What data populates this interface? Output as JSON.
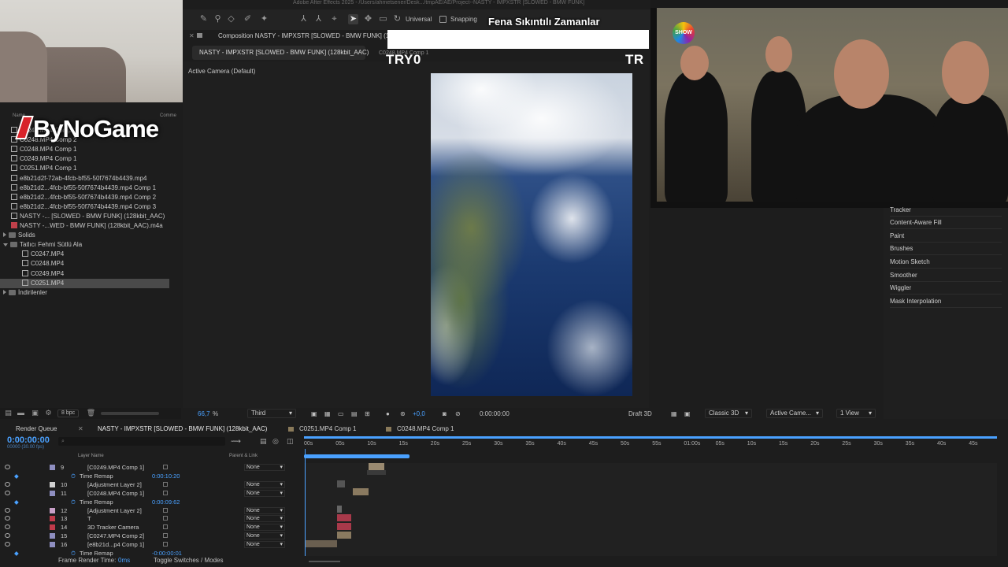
{
  "app": {
    "title": "Adobe After Effects 2025 - /Users/ahmetsener/Desk.../tmpAE/AE/Project--NASTY - IMPXSTR [SLOWED - BMW FUNK]"
  },
  "toolbar": {
    "universal": "Universal",
    "snapping": "Snapping"
  },
  "overlay": {
    "title": "Fena Sıkıntılı Zamanlar",
    "tryo_left": "TRY0",
    "tryo_right": "TR",
    "logo": "ByNoGame",
    "show_logo": "SHOW"
  },
  "project": {
    "columns": {
      "name": "Name",
      "comment": "Comme"
    },
    "items": [
      {
        "label": "C0247.MP4 Comp 1",
        "type": "comp",
        "indent": 0
      },
      {
        "label": "C0248.MP4 Comp 2",
        "type": "comp",
        "indent": 0
      },
      {
        "label": "C0248.MP4 Comp 1",
        "type": "comp",
        "indent": 0
      },
      {
        "label": "C0249.MP4 Comp 1",
        "type": "comp",
        "indent": 0
      },
      {
        "label": "C0251.MP4 Comp 1",
        "type": "comp",
        "indent": 0
      },
      {
        "label": "e8b21d2f-72ab-4fcb-bf55-50f7674b4439.mp4",
        "type": "file",
        "indent": 0
      },
      {
        "label": "e8b21d2...4fcb-bf55-50f7674b4439.mp4 Comp 1",
        "type": "comp",
        "indent": 0
      },
      {
        "label": "e8b21d2...4fcb-bf55-50f7674b4439.mp4 Comp 2",
        "type": "comp",
        "indent": 0
      },
      {
        "label": "e8b21d2...4fcb-bf55-50f7674b4439.mp4 Comp 3",
        "type": "comp",
        "indent": 0
      },
      {
        "label": "NASTY -... [SLOWED - BMW FUNK] (128kbit_AAC)",
        "type": "comp",
        "indent": 0
      },
      {
        "label": "NASTY -...WED - BMW FUNK] (128kbit_AAC).m4a",
        "type": "audio",
        "indent": 0
      },
      {
        "label": "Solids",
        "type": "folder-closed",
        "indent": 0
      },
      {
        "label": "Tatlıcı Fehmi Sütlü Ala",
        "type": "folder-open",
        "indent": 0
      },
      {
        "label": "C0247.MP4",
        "type": "file",
        "indent": 1
      },
      {
        "label": "C0248.MP4",
        "type": "file",
        "indent": 1
      },
      {
        "label": "C0249.MP4",
        "type": "file",
        "indent": 1
      },
      {
        "label": "C0251.MP4",
        "type": "file",
        "indent": 1,
        "selected": true
      },
      {
        "label": "İndirilenler",
        "type": "folder-closed",
        "indent": 0
      }
    ],
    "bpc": "8 bpc"
  },
  "composition": {
    "tab": "Composition NASTY - IMPXSTR [SLOWED - BMW FUNK] (128k",
    "subtab": "NASTY - IMPXSTR [SLOWED - BMW FUNK] (128kbit_AAC)",
    "crumb": "C0248.MP4 Comp 1",
    "camera_label": "Active Camera (Default)",
    "zoom": "66,7",
    "zoom_unit": "%",
    "resolution": "Third",
    "exposure": "+0,0",
    "timecode": "0:00:00:00",
    "renderer": "Draft 3D",
    "mode": "Classic 3D",
    "camera": "Active Came...",
    "view": "1 View"
  },
  "right_panel": {
    "items": [
      "Tracker",
      "Content-Aware Fill",
      "Paint",
      "Brushes",
      "Motion Sketch",
      "Smoother",
      "Wiggler",
      "Mask Interpolation"
    ]
  },
  "timeline": {
    "tabs": [
      "Render Queue",
      "NASTY - IMPXSTR [SLOWED - BMW FUNK] (128kbit_AAC)",
      "C0251.MP4 Comp 1",
      "C0248.MP4 Comp 1"
    ],
    "time": "0:00:00:00",
    "fps": "00000 (30.00 fps)",
    "search_placeholder": "",
    "columns": {
      "layer_name": "Layer Name",
      "parent": "Parent & Link"
    },
    "ruler": [
      "00s",
      "05s",
      "10s",
      "15s",
      "20s",
      "25s",
      "30s",
      "35s",
      "40s",
      "45s",
      "50s",
      "55s",
      "01:00s",
      "05s",
      "10s",
      "15s",
      "20s",
      "25s",
      "30s",
      "35s",
      "40s",
      "45s"
    ],
    "layers": [
      {
        "num": "9",
        "name": "[C0249.MP4 Comp 1]",
        "color": "#8e8ec0",
        "parent": "None",
        "sub": false
      },
      {
        "num": "",
        "name": "Time Remap",
        "value": "0:00:10:20",
        "sub": true
      },
      {
        "num": "10",
        "name": "[Adjustment Layer 2]",
        "color": "#d0d0d0",
        "parent": "None",
        "sub": false
      },
      {
        "num": "11",
        "name": "[C0248.MP4 Comp 1]",
        "color": "#8e8ec0",
        "parent": "None",
        "sub": false
      },
      {
        "num": "",
        "name": "Time Remap",
        "value": "0:00:09:62",
        "sub": true
      },
      {
        "num": "12",
        "name": "[Adjustment Layer 2]",
        "color": "#c8a0c8",
        "parent": "None",
        "sub": false
      },
      {
        "num": "13",
        "name": "T",
        "color": "#c03a4a",
        "parent": "None",
        "sub": false
      },
      {
        "num": "14",
        "name": "3D Tracker Camera",
        "color": "#c03a4a",
        "parent": "None",
        "sub": false
      },
      {
        "num": "15",
        "name": "[C0247.MP4 Comp 2]",
        "color": "#8e8ec0",
        "parent": "None",
        "sub": false
      },
      {
        "num": "16",
        "name": "[e8b21d...p4 Comp 1]",
        "color": "#8e8ec0",
        "parent": "None",
        "sub": false
      },
      {
        "num": "",
        "name": "Time Remap",
        "value": "-0:00:00:01",
        "sub": true
      }
    ],
    "footer": {
      "frame_render_label": "Frame Render Time:",
      "frame_render_value": "0ms",
      "toggle": "Toggle Switches / Modes"
    }
  }
}
